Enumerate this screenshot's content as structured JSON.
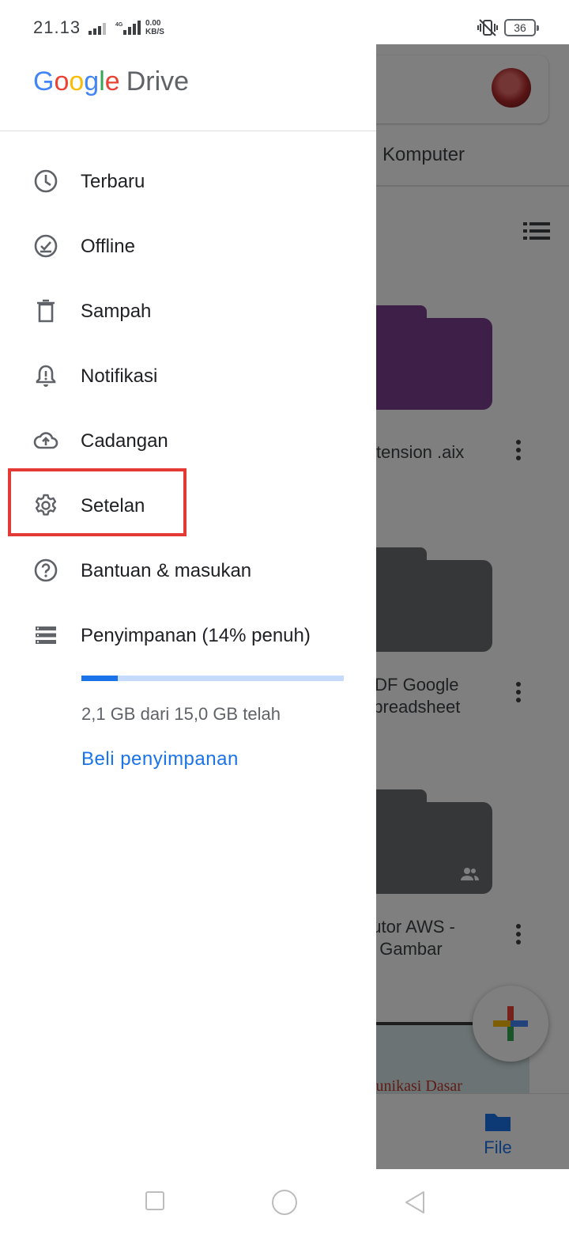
{
  "status_bar": {
    "time": "21.13",
    "network_type": "4G",
    "net_speed_value": "0.00",
    "net_speed_unit": "KB/S",
    "battery": "36",
    "icons": [
      "signal-icon",
      "signal-4g-icon",
      "vibrate-off-icon",
      "battery-icon"
    ]
  },
  "drawer": {
    "logo": {
      "g1": "G",
      "g2": "o",
      "g3": "o",
      "g4": "g",
      "g5": "l",
      "g6": "e",
      "product": "Drive"
    },
    "items": [
      {
        "label": "Terbaru",
        "icon": "clock-icon"
      },
      {
        "label": "Offline",
        "icon": "offline-icon"
      },
      {
        "label": "Sampah",
        "icon": "trash-icon"
      },
      {
        "label": "Notifikasi",
        "icon": "bell-icon"
      },
      {
        "label": "Cadangan",
        "icon": "cloud-upload-icon"
      },
      {
        "label": "Setelan",
        "icon": "gear-icon",
        "highlighted": true
      },
      {
        "label": "Bantuan & masukan",
        "icon": "help-icon"
      },
      {
        "label": "Penyimpanan (14% penuh)",
        "icon": "storage-icon"
      }
    ],
    "storage": {
      "used_fraction": 0.14,
      "text": "2,1 GB dari 15,0 GB telah",
      "buy_label": "Beli penyimpanan"
    }
  },
  "background_app": {
    "tab_label": "Komputer",
    "folders": [
      {
        "name_line1": "extension .aix",
        "name_line2": "",
        "color": "#7b3f8f"
      },
      {
        "name_line1": "PDF Google",
        "name_line2": "Spreadsheet",
        "color": "#5f6368"
      },
      {
        "name_line1": "tutor AWS -",
        "name_line2": "Gambar",
        "color": "#5f6368",
        "shared": true
      }
    ],
    "thumbnail_text": "komunikasi Dasar",
    "bottom_nav": {
      "file_label": "File"
    }
  },
  "colors": {
    "accent": "#1a73e8",
    "highlight_border": "#e53935",
    "storage_track": "#c6dafc"
  }
}
